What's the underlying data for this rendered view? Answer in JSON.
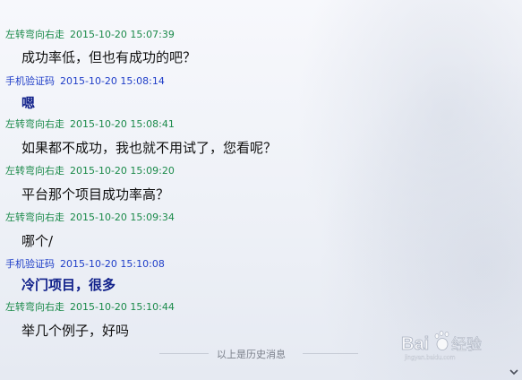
{
  "messages": [
    {
      "sender": "左转弯向右走",
      "time": "2015-10-20 15:07:39",
      "text": "成功率低，但也有成功的吧？"
    },
    {
      "sender": "手机验证码",
      "time": "2015-10-20 15:08:14",
      "text": "嗯"
    },
    {
      "sender": "左转弯向右走",
      "time": "2015-10-20 15:08:41",
      "text": "如果都不成功，我也就不用试了，您看呢？"
    },
    {
      "sender": "左转弯向右走",
      "time": "2015-10-20 15:09:20",
      "text": "平台那个项目成功率高？"
    },
    {
      "sender": "左转弯向右走",
      "time": "2015-10-20 15:09:34",
      "text": "哪个/"
    },
    {
      "sender": "手机验证码",
      "time": "2015-10-20 15:10:08",
      "text": "冷门项目，很多"
    },
    {
      "sender": "左转弯向右走",
      "time": "2015-10-20 15:10:44",
      "text": "举几个例子，好吗"
    }
  ],
  "history_divider": "以上是历史消息",
  "watermark": {
    "text": "Bai 经验",
    "subtext": "jingyan.baidu.com"
  },
  "colors": {
    "self_sender": "#1b8a4a",
    "other_sender": "#1f3ec8",
    "other_message": "#10208a"
  },
  "icons": {
    "scroll": "scroll-down-arrow-icon",
    "watermark_paw": "paw-icon"
  }
}
